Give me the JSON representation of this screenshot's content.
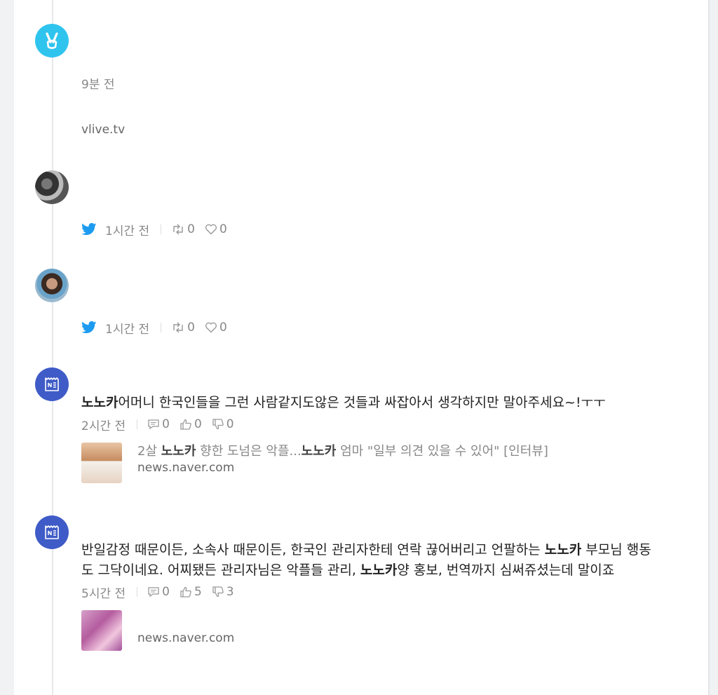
{
  "items": [
    {
      "type": "vlive",
      "time": "9분 전",
      "domain": "vlive.tv"
    },
    {
      "type": "twitter",
      "time": "1시간 전",
      "retweets": "0",
      "likes": "0"
    },
    {
      "type": "twitter",
      "time": "1시간 전",
      "retweets": "0",
      "likes": "0"
    },
    {
      "type": "news-comment",
      "highlight": "노노카",
      "text": "어머니 한국인들을 그런 사람같지도않은 것들과 싸잡아서 생각하지만 말아주세요~!ㅜㅜ",
      "time": "2시간 전",
      "comments": "0",
      "upvotes": "0",
      "downvotes": "0",
      "link": {
        "title_pre": "2살 ",
        "title_hl1": "노노카",
        "title_mid": " 향한 도넘은 악플...",
        "title_hl2": "노노카",
        "title_post": " 엄마 \"일부 의견 있을 수 있어\" [인터뷰]",
        "domain": "news.naver.com"
      }
    },
    {
      "type": "news-comment",
      "text_part1": "반일감정 때문이든, 소속사 때문이든, 한국인 관리자한테 연락 끊어버리고 언팔하는 ",
      "highlight1": "노노카",
      "text_part2": " 부모님 행동도 그닥이네요. 어찌됐든 관리자님은 악플들 관리, ",
      "highlight2": "노노카",
      "text_part3": "양 홍보, 번역까지 심써쥬셨는데 말이죠",
      "time": "5시간 전",
      "comments": "0",
      "upvotes": "5",
      "downvotes": "3",
      "link": {
        "domain": "news.naver.com"
      }
    }
  ]
}
